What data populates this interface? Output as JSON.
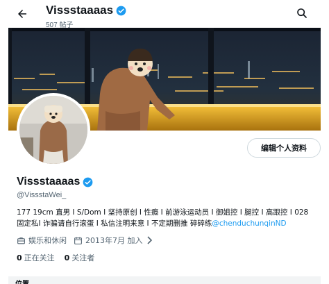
{
  "header": {
    "name": "Vissstaaaas",
    "post_count": "507 帖子"
  },
  "profile": {
    "name": "Vissstaaaas",
    "handle": "@VissstaWei_",
    "edit_button": "编辑个人资料",
    "bio_line1": "177 19cm 直男 I S/Dom I 坚持原创 I 性瘾 I 前游泳运动员 I 御姐控 I 腿控 I 高跟控 I 028",
    "bio_line2_text": "固定私I 诈骗请自行滚蛋 I 私信注明来意 I 不定期删推 碎碎练",
    "bio_line2_link": "@chenduchunqinND",
    "category": "娱乐和休闲",
    "joined": "2013年7月 加入",
    "following_count": "0",
    "following_label": "正在关注",
    "followers_count": "0",
    "followers_label": "关注者"
  },
  "bottom": {
    "label": "位置"
  },
  "icons": {
    "back": "arrow-left-icon",
    "search": "search-icon",
    "verified": "verified-badge-icon",
    "category": "briefcase-icon",
    "calendar": "calendar-icon",
    "chevron": "chevron-right-icon"
  },
  "colors": {
    "accent": "#1d9bf0",
    "text": "#0f1419",
    "secondary": "#536471"
  }
}
